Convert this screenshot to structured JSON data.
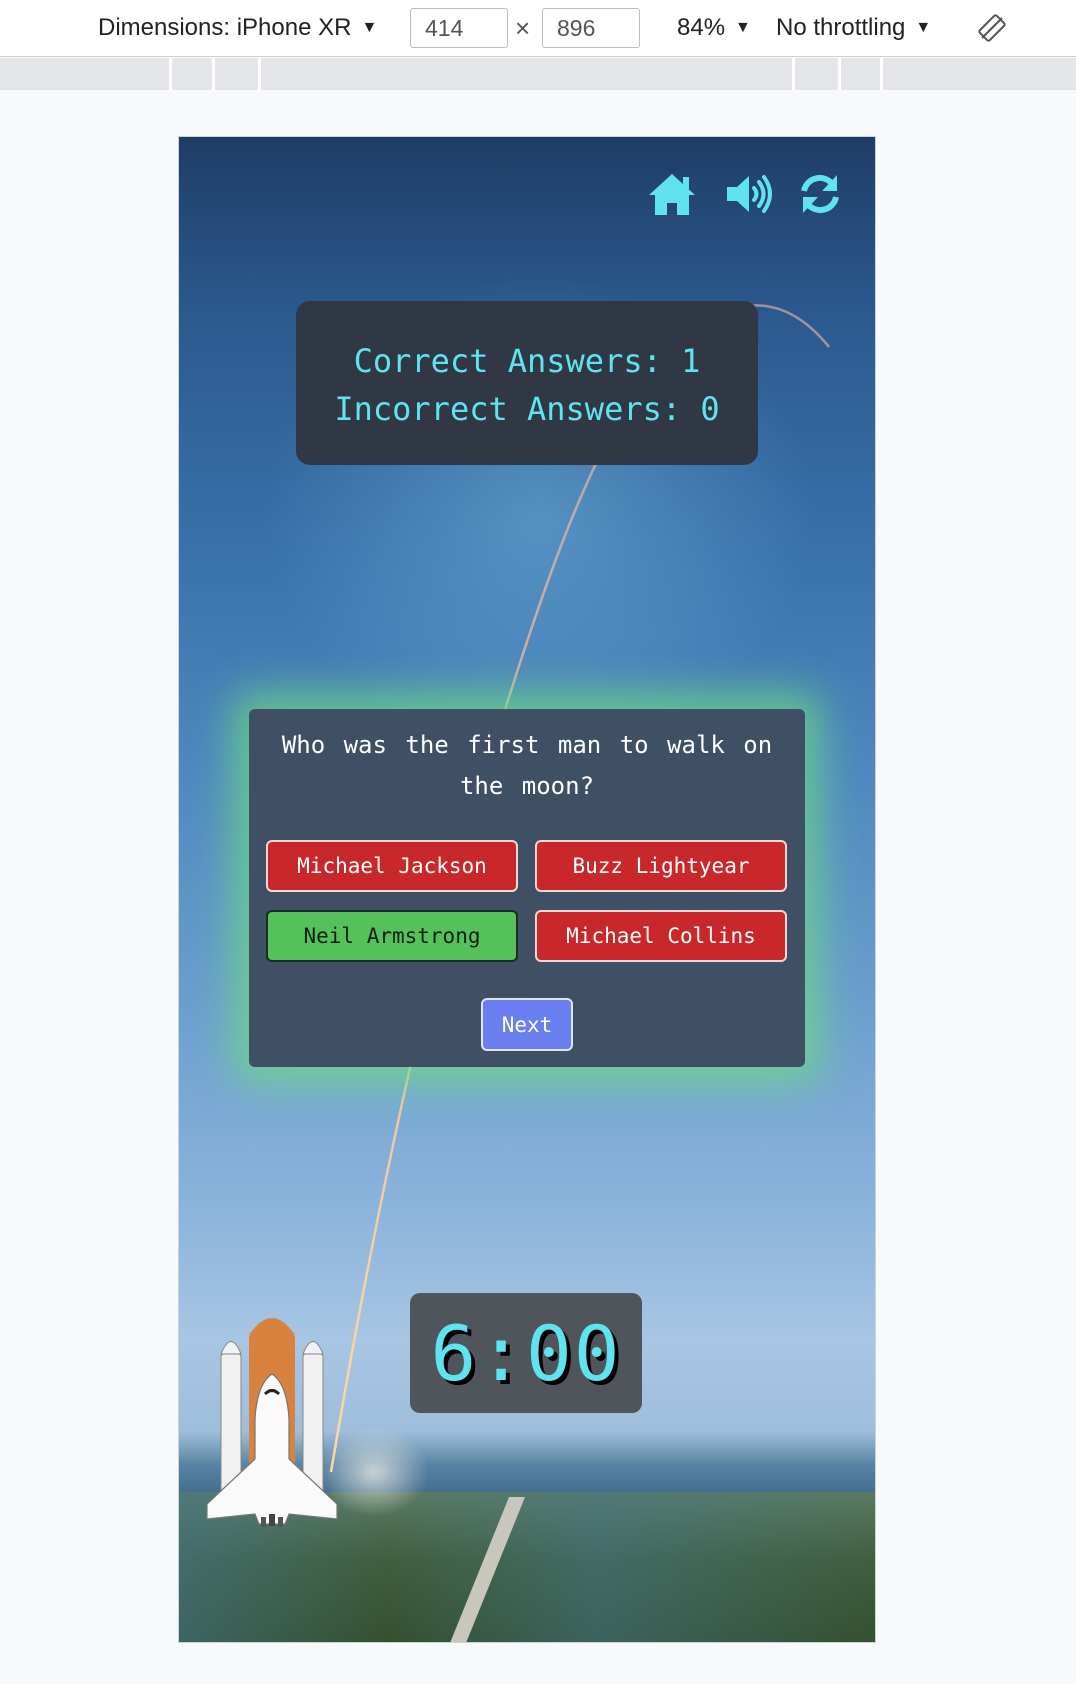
{
  "devtools": {
    "device_label": "Dimensions: iPhone XR",
    "width_value": "414",
    "times": "×",
    "height_value": "896",
    "zoom": "84%",
    "throttling": "No throttling",
    "caret": "▼"
  },
  "toolbar_icons": [
    "home-icon",
    "volume-icon",
    "refresh-icon"
  ],
  "score": {
    "correct": "Correct Answers: 1",
    "incorrect": "Incorrect Answers: 0"
  },
  "quiz": {
    "question": "Who was the first man to walk on the moon?",
    "answers": [
      {
        "label": "Michael Jackson",
        "state": "incorrect"
      },
      {
        "label": "Buzz Lightyear",
        "state": "incorrect"
      },
      {
        "label": "Neil Armstrong",
        "state": "correct"
      },
      {
        "label": "Michael Collins",
        "state": "incorrect"
      }
    ],
    "next_label": "Next"
  },
  "timer": "6:00",
  "colors": {
    "accent": "#5ee3ef",
    "correct": "#55c15b",
    "incorrect": "#c9282a",
    "next": "#6a7ff0",
    "glow": "#6edc82"
  }
}
